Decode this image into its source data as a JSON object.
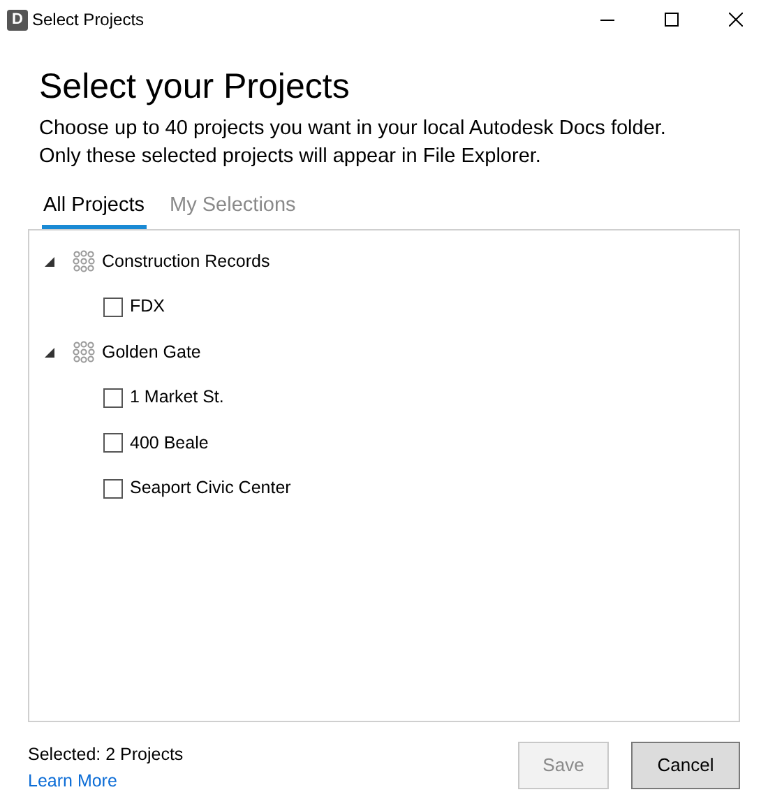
{
  "window": {
    "app_icon": "D",
    "title": "Select Projects"
  },
  "heading": "Select your Projects",
  "description": [
    "Choose up to 40 projects you want in your local Autodesk Docs folder.",
    "Only these selected projects will appear in File Explorer."
  ],
  "tabs": [
    {
      "label": "All Projects",
      "selected": true
    },
    {
      "label": "My Selections",
      "selected": false
    }
  ],
  "tree": [
    {
      "label": "Construction Records",
      "expanded": true,
      "children": [
        {
          "label": "FDX",
          "checked": false
        }
      ]
    },
    {
      "label": "Golden Gate",
      "expanded": true,
      "children": [
        {
          "label": "1 Market St.",
          "checked": false
        },
        {
          "label": "400 Beale",
          "checked": false
        },
        {
          "label": "Seaport Civic Center",
          "checked": false
        }
      ]
    }
  ],
  "footer": {
    "status": "Selected: 2 Projects",
    "link": "Learn More"
  },
  "buttons": [
    {
      "label": "Save",
      "disabled": true
    },
    {
      "label": "Cancel",
      "disabled": false
    }
  ]
}
